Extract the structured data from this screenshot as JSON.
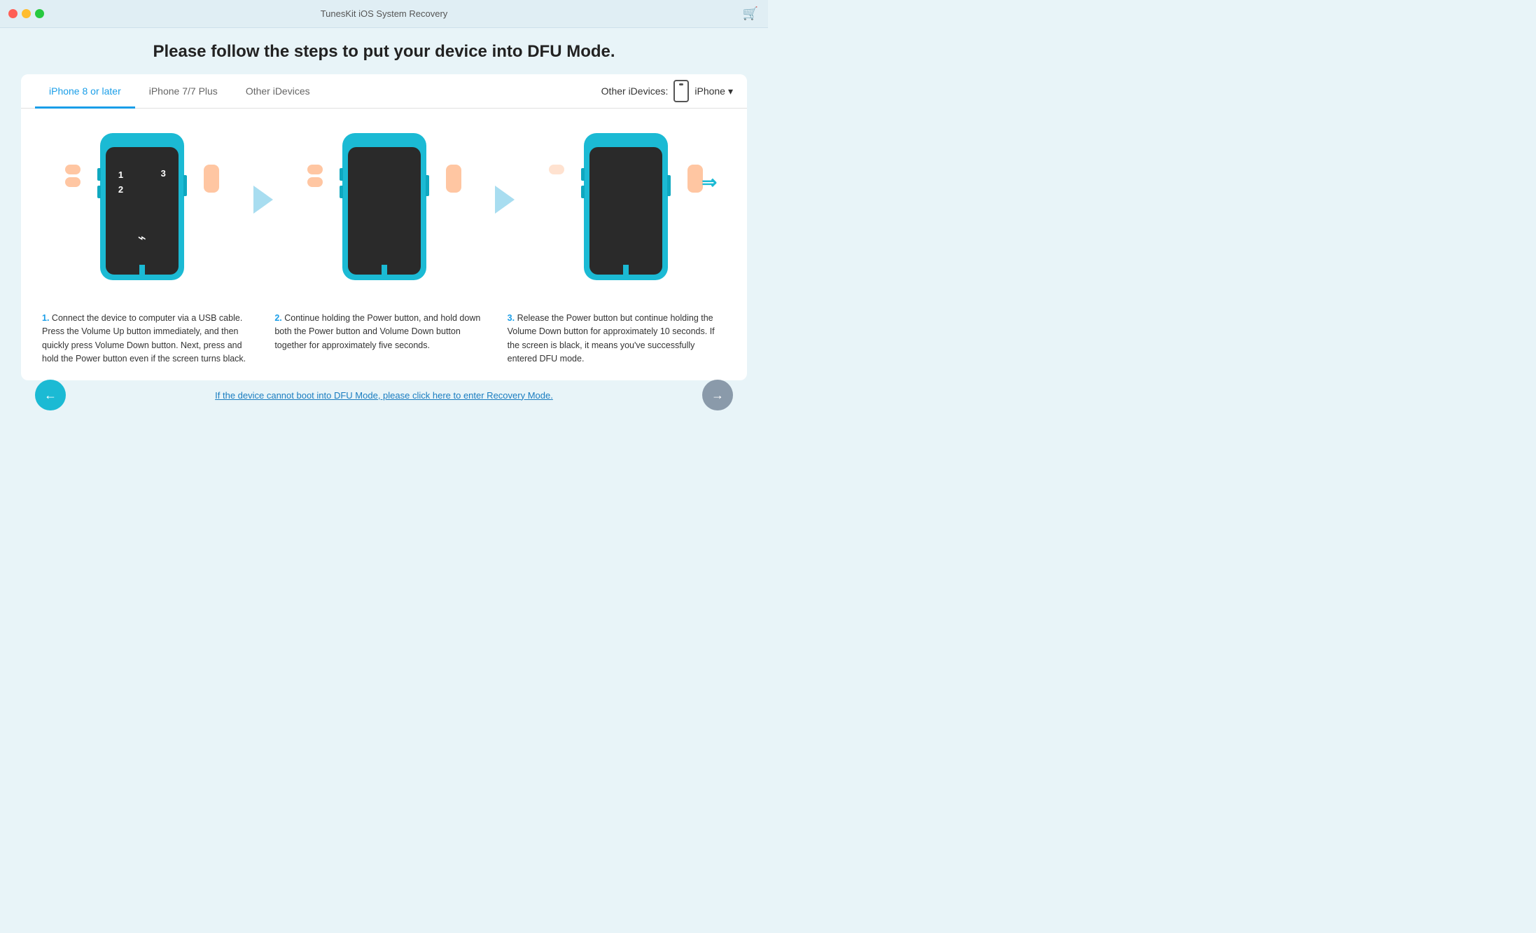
{
  "window": {
    "title": "TunesKit iOS System Recovery"
  },
  "buttons": {
    "close": "●",
    "minimize": "●",
    "maximize": "●",
    "cart": "🛒"
  },
  "page": {
    "title": "Please follow the steps to put your device into DFU Mode."
  },
  "tabs": [
    {
      "id": "tab-iphone8",
      "label": "iPhone 8 or later",
      "active": true
    },
    {
      "id": "tab-iphone7",
      "label": "iPhone 7/7 Plus",
      "active": false
    },
    {
      "id": "tab-other",
      "label": "Other iDevices",
      "active": false
    }
  ],
  "other_devices": {
    "label": "Other iDevices:",
    "device": "iPhone"
  },
  "steps": [
    {
      "number": "1",
      "screen_numbers": [
        "1",
        "2",
        "3"
      ],
      "description": "Connect the device to computer via a USB cable. Press the Volume Up button immediately, and then quickly press Volume Down button. Next, press and hold the Power button even if the screen turns black."
    },
    {
      "number": "2",
      "description": "Continue holding the Power button, and hold down both the Power button and Volume Down button together for approximately five seconds."
    },
    {
      "number": "3",
      "description": "Release the Power button but continue holding the Volume Down button for approximately 10 seconds. If the screen is black, it means you've successfully entered DFU mode."
    }
  ],
  "bottom": {
    "recovery_link": "If the device cannot boot into DFU Mode, please click here to enter Recovery Mode.",
    "back_arrow": "←",
    "next_arrow": "→"
  }
}
